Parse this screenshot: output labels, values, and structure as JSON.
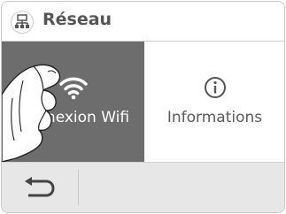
{
  "header": {
    "title": "Réseau",
    "icon": "network-icon"
  },
  "tiles": [
    {
      "label": "Connexion Wifi",
      "icon": "wifi-icon",
      "selected": true
    },
    {
      "label": "Informations",
      "icon": "info-icon",
      "selected": false
    }
  ],
  "footer": {
    "back_icon": "back-arrow-icon"
  },
  "colors": {
    "selected_tile": "#6d6d6d",
    "footer_bg": "#e7e7e7",
    "text": "#5a5a5a"
  }
}
